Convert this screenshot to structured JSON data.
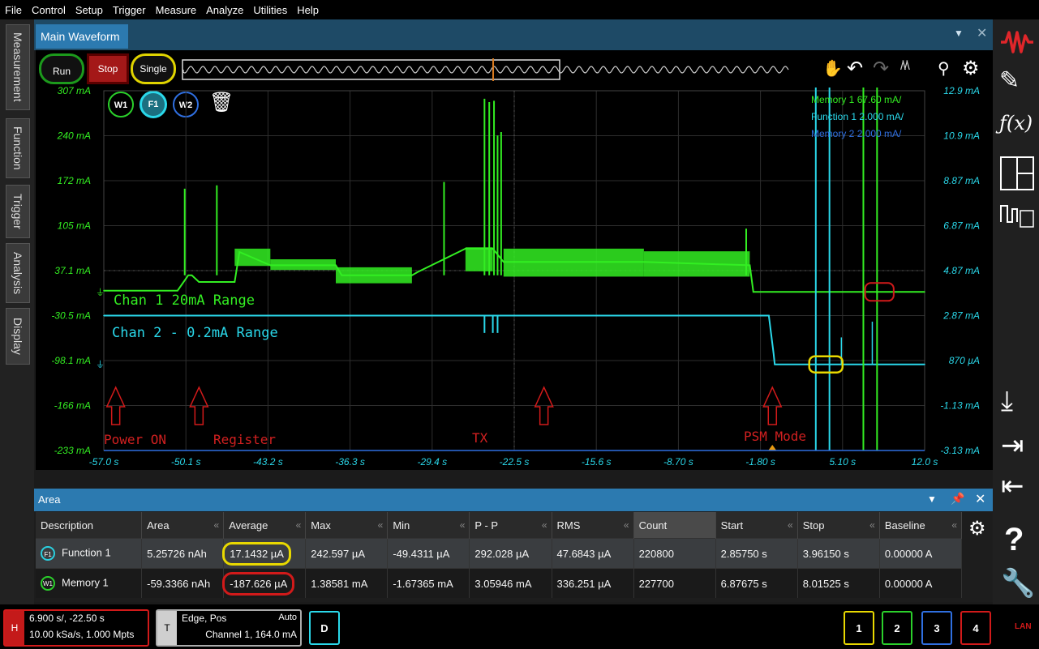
{
  "menu": [
    "File",
    "Control",
    "Setup",
    "Trigger",
    "Measure",
    "Analyze",
    "Utilities",
    "Help"
  ],
  "left_tabs": [
    "Measurement",
    "Function",
    "Trigger",
    "Analysis",
    "Display"
  ],
  "window": {
    "title": "Main Waveform"
  },
  "controls": {
    "run": "Run",
    "stop": "Stop",
    "single": "Single"
  },
  "waveform_tags": {
    "w1": "W1",
    "f1": "F1",
    "w2": "W2"
  },
  "legend": {
    "mem1_name": "Memory 1",
    "mem1_scale": "67.60 mA/",
    "fn1_name": "Function 1",
    "fn1_scale": "2.000 mA/",
    "mem2_name": "Memory 2",
    "mem2_scale": "2.000 mA/"
  },
  "colors": {
    "green": "#33ee22",
    "cyan": "#2ad8ea",
    "blue": "#2f6fe0",
    "yellow": "#e8d800",
    "red": "#d11a1a"
  },
  "chart_data": {
    "type": "line",
    "left_axis_ticks": [
      "307 mA",
      "240 mA",
      "172 mA",
      "105 mA",
      "37.1 mA",
      "-30.5 mA",
      "-98.1 mA",
      "-166 mA",
      "-233 mA"
    ],
    "right_axis_ticks": [
      "12.9 mA",
      "10.9 mA",
      "8.87 mA",
      "6.87 mA",
      "4.87 mA",
      "2.87 mA",
      "870 µA",
      "-1.13 mA",
      "-3.13 mA"
    ],
    "x_axis_ticks": [
      "-57.0 s",
      "-50.1 s",
      "-43.2 s",
      "-36.3 s",
      "-29.4 s",
      "-22.5 s",
      "-15.6 s",
      "-8.70 s",
      "-1.80 s",
      "5.10 s",
      "12.0 s"
    ],
    "xlim": [
      -57.0,
      12.0
    ],
    "ylim_left_mA": [
      -233,
      307
    ],
    "annotations": [
      "Chan 1 20mA Range",
      "Chan 2 - 0.2mA Range",
      "Power ON",
      "Register",
      "TX",
      "PSM Mode"
    ],
    "series": [
      {
        "name": "Chan 1 20mA Range",
        "color": "#33ee22",
        "x": [
          -57.0,
          -50.8,
          -49.9,
          -49.6,
          -49.0,
          -46.0,
          -45.6,
          -43.0,
          -37.5,
          -37.0,
          -31.1,
          -30.6,
          -26.6,
          -24.3,
          -23.4,
          -11.6,
          -2.7,
          -2.4,
          -0.8,
          12.0
        ],
        "y": [
          7,
          7,
          30,
          30,
          20,
          20,
          65,
          45,
          45,
          30,
          30,
          35,
          70,
          70,
          50,
          50,
          45,
          5,
          5,
          5
        ]
      },
      {
        "name": "Chan 2 - 0.2mA Range",
        "color": "#2ad8ea",
        "x": [
          -57.0,
          -1.1,
          -0.7,
          -0.6,
          0.5,
          6.0,
          12.0
        ],
        "y": [
          2.87,
          2.87,
          1.2,
          0.7,
          0.7,
          0.7,
          0.7
        ]
      }
    ]
  },
  "area_panel": {
    "title": "Area",
    "columns": [
      "Description",
      "Area",
      "Average",
      "Max",
      "Min",
      "P - P",
      "RMS",
      "Count",
      "Start",
      "Stop",
      "Baseline"
    ],
    "rows": [
      {
        "tag": "F1",
        "desc": "Function 1",
        "area": "5.25726 nAh",
        "average": "17.1432 µA",
        "max": "242.597 µA",
        "min": "-49.4311 µA",
        "pp": "292.028 µA",
        "rms": "47.6843 µA",
        "count": "220800",
        "start": "2.85750 s",
        "stop": "3.96150 s",
        "baseline": "0.00000 A"
      },
      {
        "tag": "W1",
        "desc": "Memory 1",
        "area": "-59.3366 nAh",
        "average": "-187.626 µA",
        "max": "1.38581 mA",
        "min": "-1.67365 mA",
        "pp": "3.05946 mA",
        "rms": "336.251 µA",
        "count": "227700",
        "start": "6.87675 s",
        "stop": "8.01525 s",
        "baseline": "0.00000 A"
      }
    ]
  },
  "bottom": {
    "h_label": "H",
    "h_line1": "6.900 s/, -22.50 s",
    "h_line2": "10.00 kSa/s, 1.000 Mpts",
    "t_label": "T",
    "t_line1": "Edge, Pos",
    "t_auto": "Auto",
    "t_line2": "Channel 1, 164.0 mA",
    "d_label": "D",
    "ch": [
      "1",
      "2",
      "3",
      "4"
    ],
    "lan": "LAN"
  }
}
